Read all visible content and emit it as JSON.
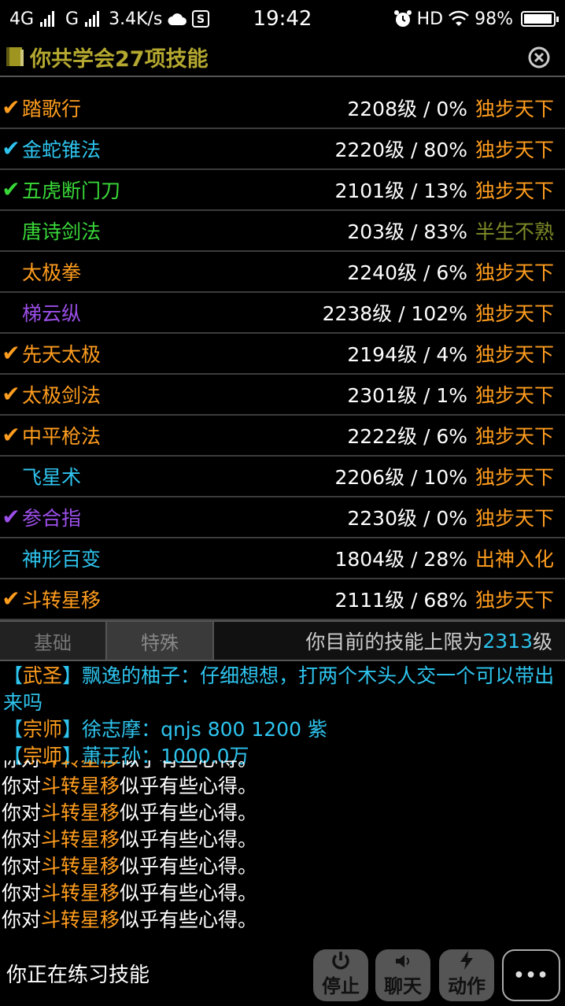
{
  "statusbar": {
    "network_4g": "4G",
    "network_g": "G",
    "speed": "3.4K/s",
    "time": "19:42",
    "hd": "HD",
    "battery": "98%",
    "battery_fraction": 0.98
  },
  "header": {
    "title": "你共学会27项技能"
  },
  "colors": {
    "orange": "#ff9d1e",
    "cyan": "#2ec4ee",
    "green": "#39d839",
    "purple": "#9b4ee8",
    "olive": "#b4a830",
    "grade_olive": "#7e8a28"
  },
  "skills": [
    {
      "check": "✔",
      "check_color": "#ff9d1e",
      "name": "踏歌行",
      "name_color": "#ff9d1e",
      "level": "2208级 / 0%",
      "grade": "独步天下",
      "grade_color": "#ff9d1e"
    },
    {
      "check": "✔",
      "check_color": "#2ec4ee",
      "name": "金蛇锥法",
      "name_color": "#2ec4ee",
      "level": "2220级 / 80%",
      "grade": "独步天下",
      "grade_color": "#ff9d1e"
    },
    {
      "check": "✔",
      "check_color": "#39d839",
      "name": "五虎断门刀",
      "name_color": "#39d839",
      "level": "2101级 / 13%",
      "grade": "独步天下",
      "grade_color": "#ff9d1e"
    },
    {
      "check": "",
      "check_color": "#39d839",
      "name": "唐诗剑法",
      "name_color": "#39d839",
      "level": "203级 / 83%",
      "grade": "半生不熟",
      "grade_color": "#7e8a28"
    },
    {
      "check": "",
      "check_color": "#ff9d1e",
      "name": "太极拳",
      "name_color": "#ff9d1e",
      "level": "2240级 / 6%",
      "grade": "独步天下",
      "grade_color": "#ff9d1e"
    },
    {
      "check": "",
      "check_color": "#9b4ee8",
      "name": "梯云纵",
      "name_color": "#9b4ee8",
      "level": "2238级 / 102%",
      "grade": "独步天下",
      "grade_color": "#ff9d1e"
    },
    {
      "check": "✔",
      "check_color": "#ff9d1e",
      "name": "先天太极",
      "name_color": "#ff9d1e",
      "level": "2194级 / 4%",
      "grade": "独步天下",
      "grade_color": "#ff9d1e"
    },
    {
      "check": "✔",
      "check_color": "#ff9d1e",
      "name": "太极剑法",
      "name_color": "#ff9d1e",
      "level": "2301级 / 1%",
      "grade": "独步天下",
      "grade_color": "#ff9d1e"
    },
    {
      "check": "✔",
      "check_color": "#ff9d1e",
      "name": "中平枪法",
      "name_color": "#ff9d1e",
      "level": "2222级 / 6%",
      "grade": "独步天下",
      "grade_color": "#ff9d1e"
    },
    {
      "check": "",
      "check_color": "#2ec4ee",
      "name": "飞星术",
      "name_color": "#2ec4ee",
      "level": "2206级 / 10%",
      "grade": "独步天下",
      "grade_color": "#ff9d1e"
    },
    {
      "check": "✔",
      "check_color": "#9b4ee8",
      "name": "参合指",
      "name_color": "#9b4ee8",
      "level": "2230级 / 0%",
      "grade": "独步天下",
      "grade_color": "#ff9d1e"
    },
    {
      "check": "",
      "check_color": "#2ec4ee",
      "name": "神形百变",
      "name_color": "#2ec4ee",
      "level": "1804级 / 28%",
      "grade": "出神入化",
      "grade_color": "#ff9d1e"
    },
    {
      "check": "✔",
      "check_color": "#ff9d1e",
      "name": "斗转星移",
      "name_color": "#ff9d1e",
      "level": "2111级 / 68%",
      "grade": "独步天下",
      "grade_color": "#ff9d1e"
    }
  ],
  "tabs": {
    "basic": "基础",
    "special": "特殊",
    "limit_prefix": "你目前的技能上限为",
    "limit_value": "2313",
    "limit_suffix": "级"
  },
  "chat": [
    {
      "open": "【",
      "rank": "武圣",
      "close": "】",
      "speaker": "飘逸的柚子",
      "sep": "：",
      "message": "仔细想想，打两个木头人交一个可以带出来吗"
    },
    {
      "open": "【",
      "rank": "宗师",
      "close": "】",
      "speaker": "徐志摩",
      "sep": "：",
      "message": "qnjs 800 1200 紫"
    },
    {
      "open": "【",
      "rank": "宗师",
      "close": "】",
      "speaker": "萧王孙",
      "sep": "：",
      "message": "1000.0万"
    }
  ],
  "log": {
    "prefix": "你对",
    "skill": "斗转星移",
    "suffix": "似乎有些心得。",
    "count": 7
  },
  "bottom": {
    "status": "你正在练习技能",
    "stop": "停止",
    "chat": "聊天",
    "action": "动作",
    "more": "•••"
  }
}
